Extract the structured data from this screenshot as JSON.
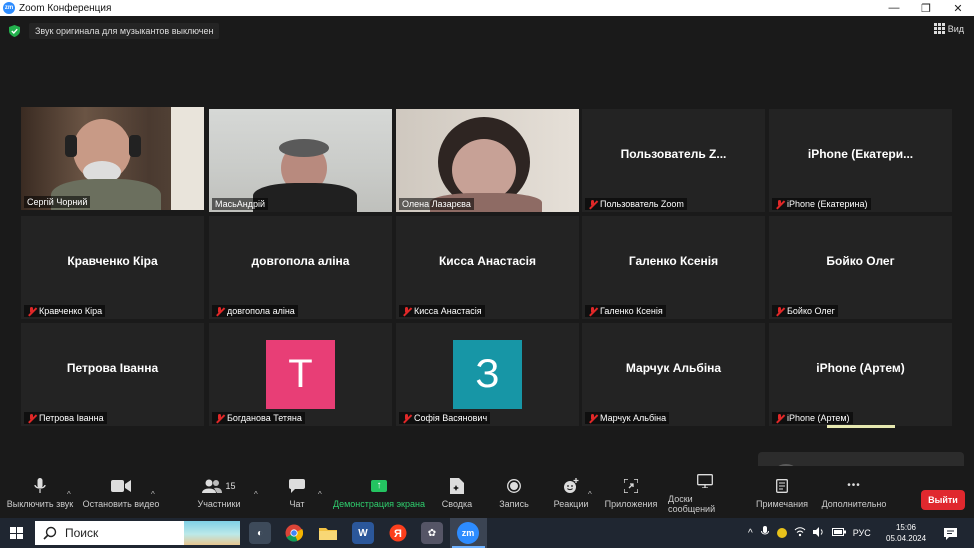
{
  "window": {
    "title": "Zoom Конференция",
    "logo_text": "zm",
    "minimize": "—",
    "restore": "❐",
    "close": "✕"
  },
  "topbar": {
    "notice": "Звук оригинала для музыкантов выключен",
    "view_label": "Вид"
  },
  "tiles": [
    {
      "label": "Сергій Чорний"
    },
    {
      "label": "МасьАндрій"
    },
    {
      "label": "Олена Лазарєва"
    },
    {
      "big": "Пользователь  Z...",
      "label": "Пользователь Zoom"
    },
    {
      "big": "iPhone  (Екатери...",
      "label": "iPhone (Екатерина)"
    },
    {
      "big": "Кравченко Кіра",
      "label": "Кравченко Кіра"
    },
    {
      "big": "довгопола аліна",
      "label": "довгопола аліна"
    },
    {
      "big": "Кисса Анастасія",
      "label": "Кисса Анастасія"
    },
    {
      "big": "Галенко Ксенія",
      "label": "Галенко Ксенія"
    },
    {
      "big": "Бойко Олег",
      "label": "Бойко Олег"
    },
    {
      "big": "Петрова Іванна",
      "label": "Петрова Іванна"
    },
    {
      "avatar": "T",
      "label": "Богданова Тетяна"
    },
    {
      "avatar": "З",
      "label": "Софія Васянович"
    },
    {
      "big": "Марчук Альбіна",
      "label": "Марчук Альбіна"
    },
    {
      "big": "iPhone (Артем)",
      "label": "iPhone (Артем)"
    }
  ],
  "colors": {
    "active_border": "#c4e13f",
    "avatar_t": "#e83e76",
    "avatar_z": "#1796a6",
    "share_green": "#24c461",
    "leave_red": "#e0282e"
  },
  "toolbar": {
    "mute": "Выключить звук",
    "video": "Остановить видео",
    "participants": "Участники",
    "participants_count": "15",
    "chat": "Чат",
    "share": "Демонстрация экрана",
    "summary": "Сводка",
    "record": "Запись",
    "reactions": "Реакции",
    "apps": "Приложения",
    "whiteboards": "Доски сообщений",
    "notes": "Примечания",
    "more": "Дополнительно",
    "leave": "Выйти",
    "caret": "^",
    "more_dots": "•••"
  },
  "taskbar": {
    "search_placeholder": "Поиск",
    "language": "РУС",
    "time": "15:06",
    "date": "05.04.2024",
    "tray_chevron": "^"
  }
}
